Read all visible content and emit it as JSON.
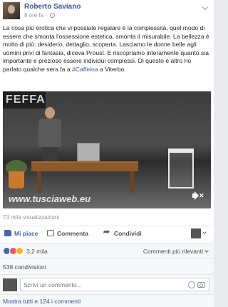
{
  "post": {
    "author": "Roberto Saviano",
    "time": "8 ore fa",
    "time_sep": " · ",
    "text_before": "La cosa più erotica che vi possiate regalare è la complessità, quel modo di essere che smonta l'ossessione estetica, smonta il misurabile. La bellezza è molto di più: desiderio, dettaglio, scoperta. Lasciamo le donne belle agli uomini privi di fantasia, diceva Proust. E riscopriamo interamente quanto sia importante e prezioso essere individui complessi. Di questo e altro ho parlato qualche sera fa a ",
    "hashtag": "#Caffeina",
    "text_after": " a Viterbo."
  },
  "video": {
    "banner_text": "FEFFA",
    "watermark": "www.tusciaweb.eu"
  },
  "views": "73 mila visualizzazioni",
  "actions": {
    "like": "Mi piace",
    "comment": "Commenta",
    "share": "Condividi"
  },
  "reactions": {
    "count": "3,2 mila",
    "sort_label": "Commenti più rilevanti"
  },
  "shares": "538 condivisioni",
  "comment_box": {
    "placeholder": "Scrivi un commento..."
  },
  "more_comments": "Mostra tutti e 124 i commenti",
  "colors": {
    "link": "#365899",
    "like_blue": "#4267b2",
    "muted": "#90949c"
  }
}
